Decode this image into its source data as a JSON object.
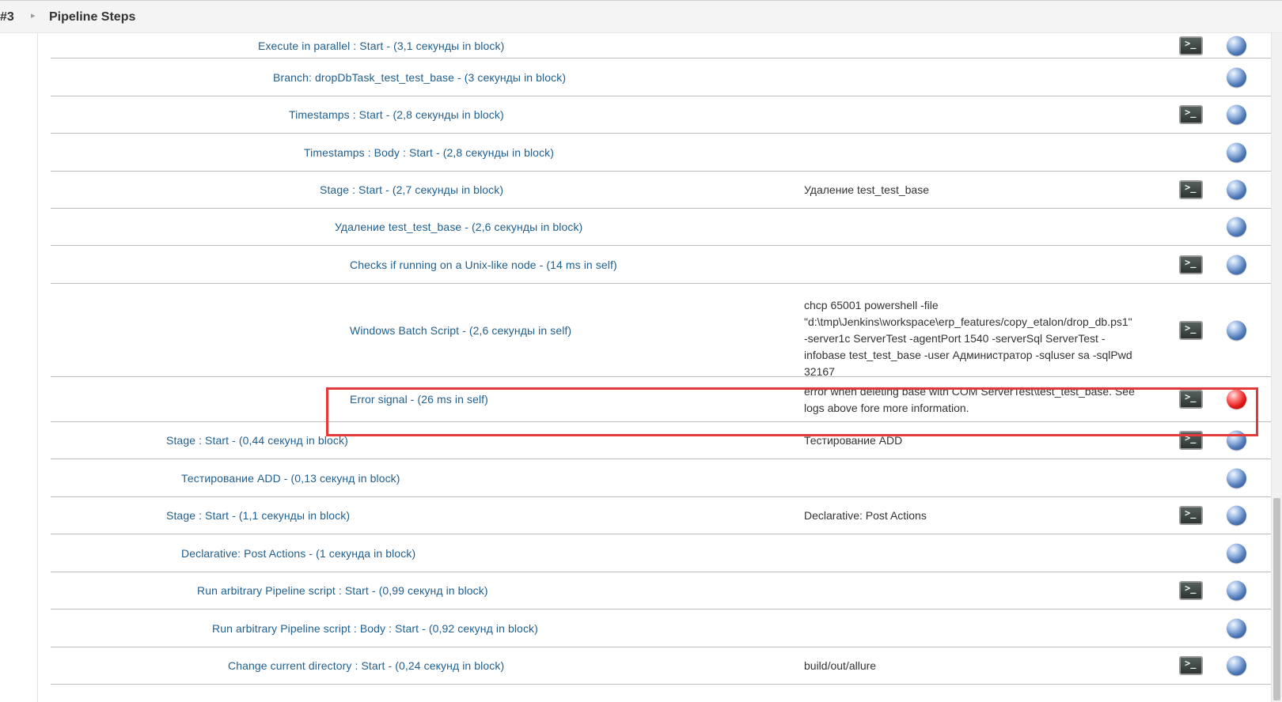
{
  "header": {
    "build_number": "#3",
    "title": "Pipeline Steps"
  },
  "steps": [
    {
      "label": "Execute in parallel : Start - (3,1 секунды in block)",
      "args": "",
      "console": true,
      "status": "blue"
    },
    {
      "label": "Branch: dropDbTask_test_test_base - (3 секунды in block)",
      "args": "",
      "console": false,
      "status": "blue"
    },
    {
      "label": "Timestamps : Start - (2,8 секунды in block)",
      "args": "",
      "console": true,
      "status": "blue"
    },
    {
      "label": "Timestamps : Body : Start - (2,8 секунды in block)",
      "args": "",
      "console": false,
      "status": "blue"
    },
    {
      "label": "Stage : Start - (2,7 секунды in block)",
      "args": "Удаление test_test_base",
      "console": true,
      "status": "blue"
    },
    {
      "label": "Удаление test_test_base - (2,6 секунды in block)",
      "args": "",
      "console": false,
      "status": "blue"
    },
    {
      "label": "Checks if running on a Unix-like node - (14 ms in self)",
      "args": "",
      "console": true,
      "status": "blue"
    },
    {
      "label": "Windows Batch Script - (2,6 секунды in self)",
      "args": "chcp 65001 powershell -file \"d:\\tmp\\Jenkins\\workspace\\erp_features/copy_etalon/drop_db.ps1\" -server1c ServerTest -agentPort 1540 -serverSql ServerTest -infobase test_test_base -user Администратор -sqluser sa -sqlPwd 32167",
      "console": true,
      "status": "blue"
    },
    {
      "label": "Error signal - (26 ms in self)",
      "args": "error when deleting base with COM ServerTest\\test_test_base. See logs above fore more information.",
      "console": true,
      "status": "red"
    },
    {
      "label": "Stage : Start - (0,44 секунд in block)",
      "args": "Тестирование ADD",
      "console": true,
      "status": "blue"
    },
    {
      "label": "Тестирование ADD - (0,13 секунд in block)",
      "args": "",
      "console": false,
      "status": "blue"
    },
    {
      "label": "Stage : Start - (1,1 секунды in block)",
      "args": "Declarative: Post Actions",
      "console": true,
      "status": "blue"
    },
    {
      "label": "Declarative: Post Actions - (1 секунда in block)",
      "args": "",
      "console": false,
      "status": "blue"
    },
    {
      "label": "Run arbitrary Pipeline script : Start - (0,99 секунд in block)",
      "args": "",
      "console": true,
      "status": "blue"
    },
    {
      "label": "Run arbitrary Pipeline script : Body : Start - (0,92 секунд in block)",
      "args": "",
      "console": false,
      "status": "blue"
    },
    {
      "label": "Change current directory : Start - (0,24 секунд in block)",
      "args": "build/out/allure",
      "console": true,
      "status": "blue"
    }
  ],
  "icons": {
    "console": "console-terminal-icon",
    "status_ok": "blue-ball-status-icon",
    "status_failed": "red-ball-status-icon"
  },
  "colors": {
    "link": "#1f5f8f",
    "highlight": "#e3393a",
    "status_ok": "#4d77b6",
    "status_failed": "#e01818"
  }
}
